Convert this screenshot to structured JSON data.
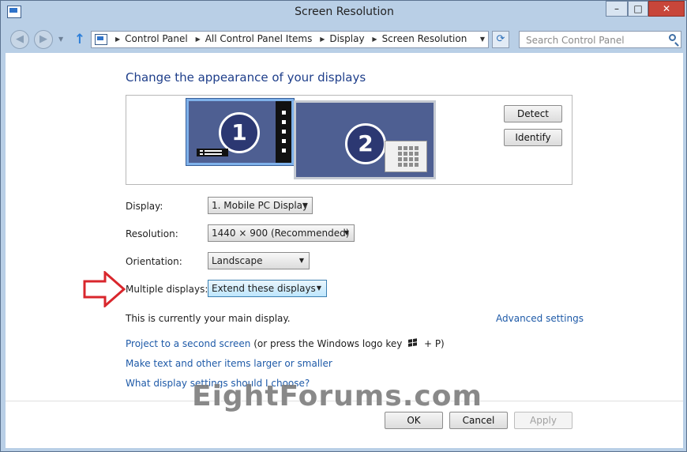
{
  "window": {
    "title": "Screen Resolution"
  },
  "titlebar": {
    "minimize": "–",
    "maximize": "□",
    "close": "✕"
  },
  "nav": {
    "back_icon": "back-icon",
    "forward_icon": "forward-icon",
    "up_icon": "up-arrow-icon",
    "breadcrumbs": [
      "Control Panel",
      "All Control Panel Items",
      "Display",
      "Screen Resolution"
    ],
    "search_placeholder": "Search Control Panel"
  },
  "main": {
    "title": "Change the appearance of your displays",
    "monitors": [
      {
        "number": "1"
      },
      {
        "number": "2"
      }
    ],
    "detect_label": "Detect",
    "identify_label": "Identify",
    "fields": {
      "display": {
        "label": "Display:",
        "value": "1. Mobile PC Display"
      },
      "resolution": {
        "label": "Resolution:",
        "value": "1440 × 900 (Recommended)"
      },
      "orientation": {
        "label": "Orientation:",
        "value": "Landscape"
      },
      "multiple": {
        "label": "Multiple displays:",
        "value": "Extend these displays"
      }
    },
    "main_display_note": "This is currently your main display.",
    "advanced_link": "Advanced settings",
    "project_link": "Project to a second screen",
    "project_note_before": " (or press the Windows logo key ",
    "project_note_after": " + P)",
    "larger_link": "Make text and other items larger or smaller",
    "choose_link": "What display settings should I choose?"
  },
  "footer": {
    "ok": "OK",
    "cancel": "Cancel",
    "apply": "Apply"
  },
  "watermark": "EightForums.com",
  "colors": {
    "link": "#1e5aa8",
    "heading": "#1e3e8a",
    "callout_arrow": "#d9262c"
  }
}
